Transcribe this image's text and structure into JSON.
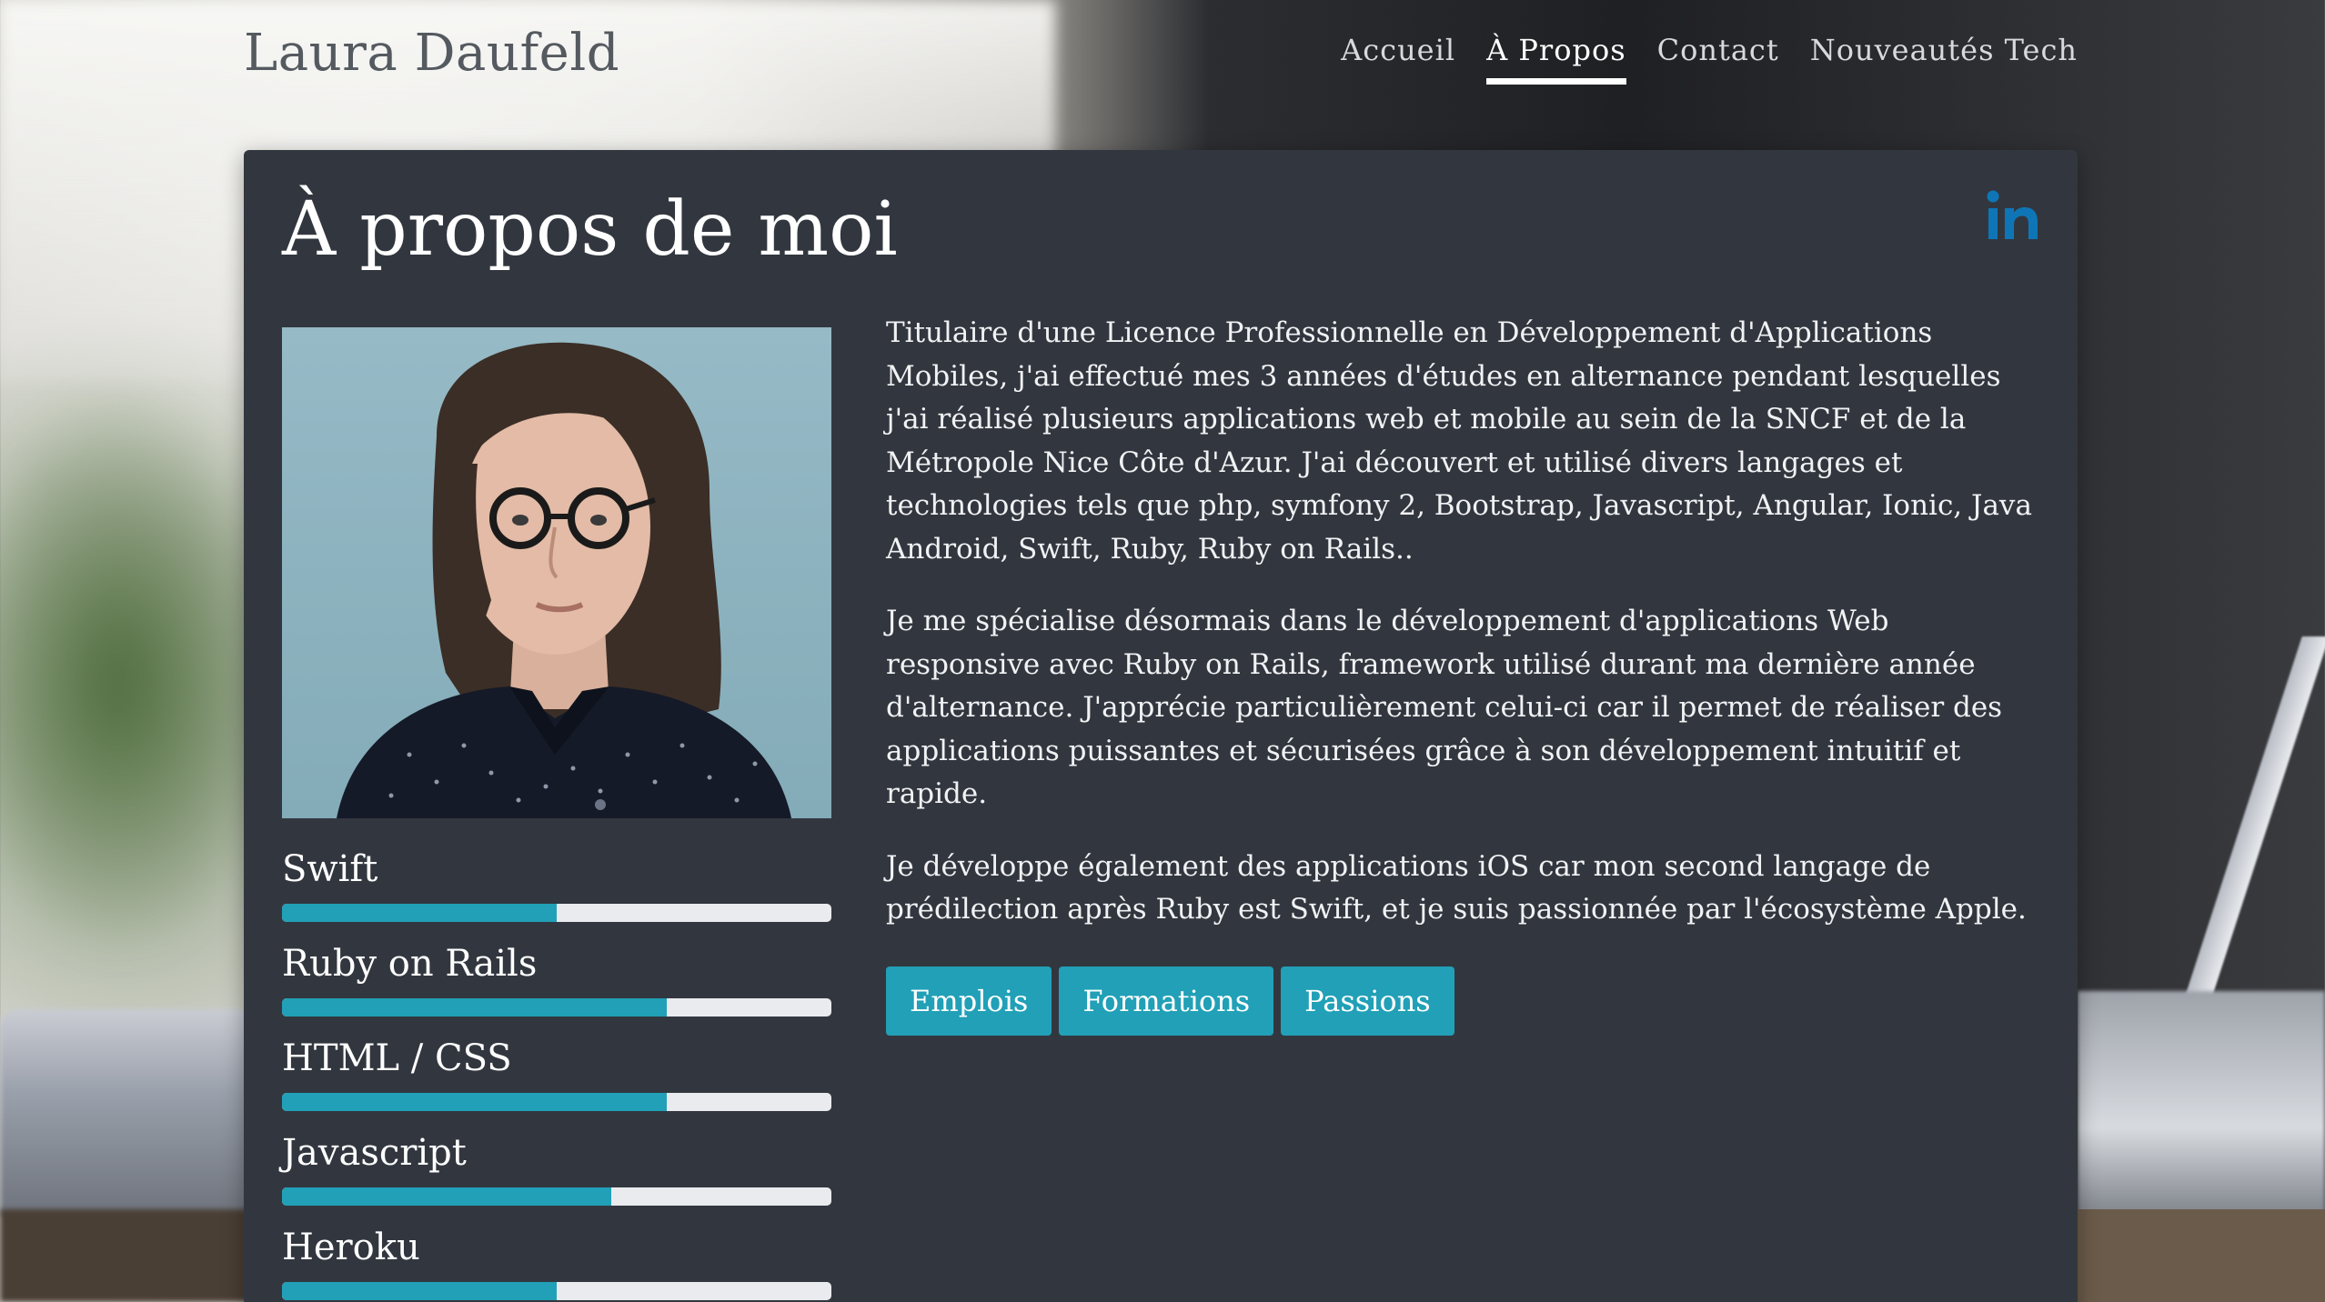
{
  "header": {
    "brand": "Laura Daufeld",
    "nav": [
      {
        "label": "Accueil",
        "active": false
      },
      {
        "label": "À Propos",
        "active": true
      },
      {
        "label": "Contact",
        "active": false
      },
      {
        "label": "Nouveautés Tech",
        "active": false
      }
    ]
  },
  "card": {
    "title": "À propos de moi",
    "social_icon": "linkedin-icon",
    "photo_icon": "profile-photo",
    "paragraphs": [
      "Titulaire d'une Licence Professionnelle en Développement d'Applications Mobiles, j'ai effectué mes 3 années d'études en alternance pendant lesquelles j'ai réalisé plusieurs applications web et mobile au sein de la SNCF et de la Métropole Nice Côte d'Azur. J'ai découvert et utilisé divers langages et technologies tels que php, symfony 2, Bootstrap, Javascript, Angular, Ionic, Java Android, Swift, Ruby, Ruby on Rails..",
      "Je me spécialise désormais dans le développement d'applications Web responsive avec Ruby on Rails, framework utilisé durant ma dernière année d'alternance. J'apprécie particulièrement celui-ci car il permet de réaliser des applications puissantes et sécurisées grâce à son développement intuitif et rapide.",
      "Je développe également des applications iOS car mon second langage de prédilection après Ruby est Swift, et je suis passionnée par l'écosystème Apple."
    ],
    "buttons": [
      "Emplois",
      "Formations",
      "Passions"
    ],
    "skills": [
      {
        "name": "Swift",
        "level": 0.5
      },
      {
        "name": "Ruby on Rails",
        "level": 0.7
      },
      {
        "name": "HTML / CSS",
        "level": 0.7
      },
      {
        "name": "Javascript",
        "level": 0.6
      },
      {
        "name": "Heroku",
        "level": 0.5
      }
    ]
  },
  "colors": {
    "accent": "#21a0b7",
    "card_bg": "#32373f",
    "linkedin": "#0e76b7",
    "track": "#e9ebee"
  }
}
